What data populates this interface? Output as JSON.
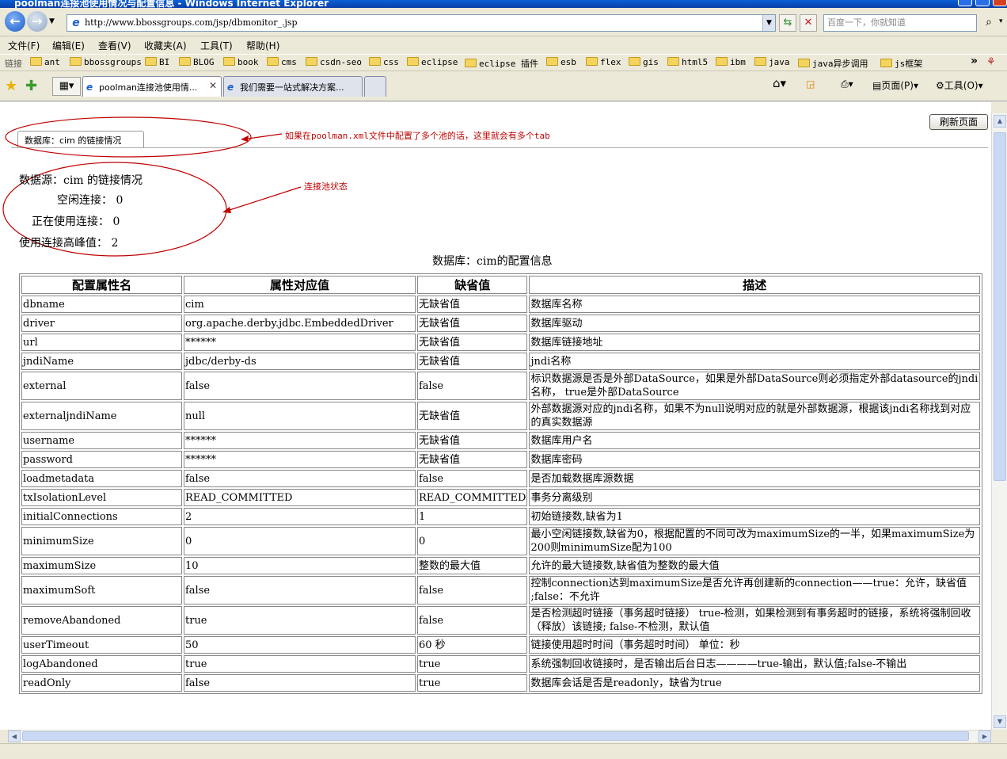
{
  "window": {
    "title": "poolman连接池使用情况与配置信息 - Windows Internet Explorer"
  },
  "address": {
    "url": "http://www.bbossgroups.com/jsp/dbmonitor_.jsp",
    "search_placeholder": "百度一下，你就知道"
  },
  "menu": [
    "文件(F)",
    "编辑(E)",
    "查看(V)",
    "收藏夹(A)",
    "工具(T)",
    "帮助(H)"
  ],
  "links": {
    "label": "链接",
    "items": [
      "ant",
      "bbossgroups",
      "BI",
      "BLOG",
      "book",
      "cms",
      "csdn-seo",
      "css",
      "eclipse",
      "eclipse 插件",
      "esb",
      "flex",
      "gis",
      "html5",
      "ibm",
      "java",
      "java异步调用",
      "js框架"
    ]
  },
  "tabs": [
    {
      "label": "poolman连接池使用情...",
      "active": true
    },
    {
      "label": "我们需要一站式解决方案...",
      "active": false
    }
  ],
  "commandbar": {
    "page": "页面(P)",
    "tools": "工具(O)"
  },
  "page": {
    "refresh_button": "刷新页面",
    "pool_tab": "数据库：cim 的链接情况",
    "annotation_tab": "如果在poolman.xml文件中配置了多个池的话，这里就会有多个tab",
    "annotation_status": "连接池状态",
    "status": {
      "heading": "数据源：cim 的链接情况",
      "idle": "空闲连接： 0",
      "in_use": "正在使用连接： 0",
      "peak": "使用连接高峰值： 2"
    },
    "config_title": "数据库：cim的配置信息",
    "table": {
      "headers": [
        "配置属性名",
        "属性对应值",
        "缺省值",
        "描述"
      ],
      "rows": [
        [
          "dbname",
          "cim",
          "无缺省值",
          "数据库名称"
        ],
        [
          "driver",
          "org.apache.derby.jdbc.EmbeddedDriver",
          "无缺省值",
          "数据库驱动"
        ],
        [
          "url",
          "******",
          "无缺省值",
          "数据库链接地址"
        ],
        [
          "jndiName",
          "jdbc/derby-ds",
          "无缺省值",
          "jndi名称"
        ],
        [
          "external",
          "false",
          "false",
          "标识数据源是否是外部DataSource，如果是外部DataSource则必须指定外部datasource的jndi名称， true是外部DataSource"
        ],
        [
          "externaljndiName",
          "null",
          "无缺省值",
          "外部数据源对应的jndi名称，如果不为null说明对应的就是外部数据源，根据该jndi名称找到对应的真实数据源"
        ],
        [
          "username",
          "******",
          "无缺省值",
          "数据库用户名"
        ],
        [
          "password",
          "******",
          "无缺省值",
          "数据库密码"
        ],
        [
          "loadmetadata",
          "false",
          "false",
          "是否加载数据库源数据"
        ],
        [
          "txIsolationLevel",
          "READ_COMMITTED",
          "READ_COMMITTED",
          "事务分离级别"
        ],
        [
          "initialConnections",
          "2",
          "1",
          "初始链接数,缺省为1"
        ],
        [
          "minimumSize",
          "0",
          "0",
          "最小空闲链接数,缺省为0，根据配置的不同可改为maximumSize的一半，如果maximumSize为200则minimumSize配为100"
        ],
        [
          "maximumSize",
          "10",
          "整数的最大值",
          "允许的最大链接数,缺省值为整数的最大值"
        ],
        [
          "maximumSoft",
          "false",
          "false",
          "控制connection达到maximumSize是否允许再创建新的connection——true：允许，缺省值 ;false：不允许"
        ],
        [
          "removeAbandoned",
          "true",
          "false",
          "是否检测超时链接（事务超时链接） true-检测，如果检测到有事务超时的链接，系统将强制回收（释放）该链接; false-不检测，默认值"
        ],
        [
          "userTimeout",
          "50",
          "60 秒",
          "链接使用超时时间（事务超时时间） 单位：秒"
        ],
        [
          "logAbandoned",
          "true",
          "true",
          "系统强制回收链接时，是否输出后台日志————true-输出，默认值;false-不输出"
        ],
        [
          "readOnly",
          "false",
          "true",
          "数据库会话是否是readonly，缺省为true"
        ]
      ]
    }
  }
}
